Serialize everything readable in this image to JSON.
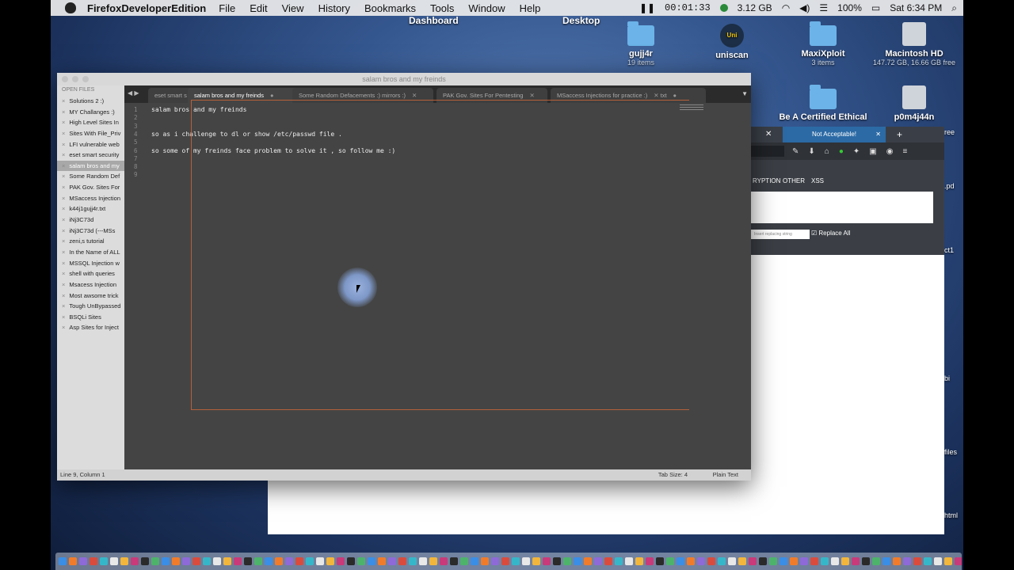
{
  "menubar": {
    "app_name": "FirefoxDeveloperEdition",
    "items": [
      "File",
      "Edit",
      "View",
      "History",
      "Bookmarks",
      "Tools",
      "Window",
      "Help"
    ],
    "recording_time": "00:01:33",
    "memory": "3.12 GB",
    "battery": "100%",
    "clock": "Sat 6:34 PM"
  },
  "desktop": {
    "spaces": [
      "Dashboard",
      "Desktop"
    ],
    "icons": [
      {
        "name": "gujj4r",
        "sub": "19 items",
        "kind": "folder"
      },
      {
        "name": "uniscan",
        "sub": "",
        "kind": "uniscan"
      },
      {
        "name": "MaxiXploit",
        "sub": "3 items",
        "kind": "folder"
      },
      {
        "name": "Macintosh HD",
        "sub": "147.72 GB, 16.66 GB free",
        "kind": "disk"
      },
      {
        "name": "Be A Certified Ethical",
        "sub": "",
        "kind": "folder"
      },
      {
        "name": "p0m4j44n",
        "sub": "",
        "kind": "disk"
      }
    ],
    "fragments": [
      "ree",
      ".pd",
      "ct1",
      "bi",
      "files",
      "html"
    ]
  },
  "firefox": {
    "tab_title": "Not Acceptable!",
    "hackbar_items": [
      "RYPTION",
      "OTHER",
      "XSS"
    ],
    "replace_placeholder": "Insert replacing string",
    "replace_all_label": "Replace All"
  },
  "sublime": {
    "title": "salam bros and my freinds",
    "sidebar_header": "OPEN FILES",
    "files": [
      "Solutions 2 :)",
      "MY Challanges :)",
      "High Level Sites In",
      "Sites With File_Priv",
      "LFI vulnerable web",
      "eset smart security",
      "salam bros and my",
      "Some Random Def",
      "PAK Gov. Sites For",
      "MSaccess Injection",
      "k44j1gujj4r.txt",
      "iNj3C73d",
      "iNj3C73d (---MSs",
      "zeni,s tutorial",
      "In the Name of ALL",
      "MSSQL Injection w",
      "shell with queries",
      "Msacess Injection",
      "Most awsome trick",
      "Tough UnBypassed",
      "BSQLi Sites",
      "Asp Sites for Inject"
    ],
    "selected_file_index": 6,
    "tabs": [
      {
        "label": "eset smart s"
      },
      {
        "label": "salam bros and my freinds"
      },
      {
        "label": "Some Random Defacements :) mirrors :)"
      },
      {
        "label": "PAK Gov. Sites For Pentesting"
      },
      {
        "label": "MSaccess Injections for practice :)"
      },
      {
        "label": "txt"
      }
    ],
    "active_tab_index": 1,
    "line_numbers": [
      "1",
      "2",
      "3",
      "4",
      "5",
      "6",
      "7",
      "8",
      "9"
    ],
    "code_lines": [
      "salam bros and my freinds",
      "",
      "",
      "so as i challenge to dl or show /etc/passwd file .",
      "",
      "so some of my freinds face problem to solve it , so follow me :)",
      "",
      "",
      ""
    ],
    "status_left": "Line 9, Column 1",
    "status_tab_size": "Tab Size: 4",
    "status_syntax": "Plain Text"
  }
}
